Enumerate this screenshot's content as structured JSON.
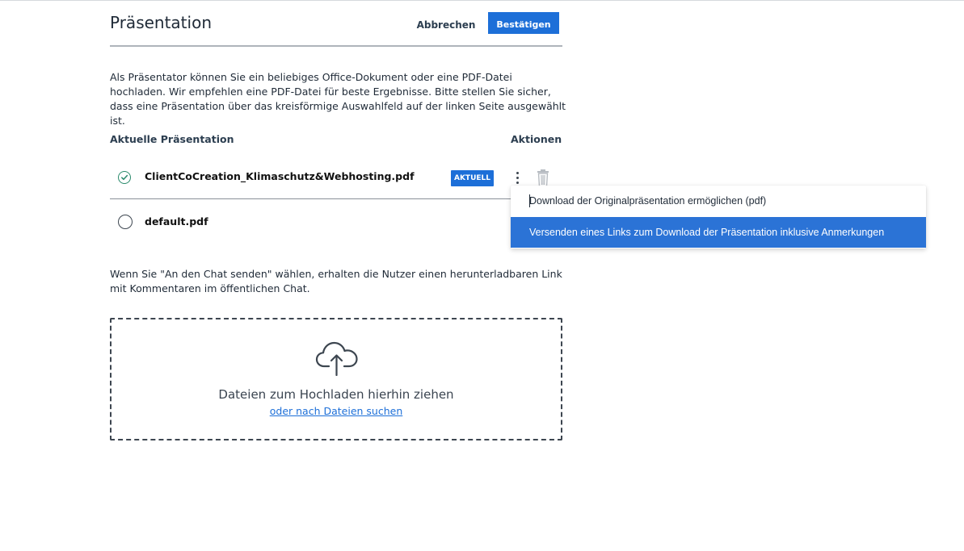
{
  "header": {
    "title": "Präsentation",
    "cancel_label": "Abbrechen",
    "confirm_label": "Bestätigen"
  },
  "intro": {
    "text": "Als Präsentator können Sie ein beliebiges Office-Dokument oder eine PDF-Datei hochladen. Wir empfehlen eine PDF-Datei für beste Ergebnisse. Bitte stellen Sie sicher, dass eine Präsentation über das kreisförmige Auswahlfeld auf der linken Seite ausgewählt ist."
  },
  "table": {
    "col_current": "Aktuelle Präsentation",
    "col_actions": "Aktionen",
    "rows": [
      {
        "name": "ClientCoCreation_Klimaschutz&Webhosting.pdf",
        "badge": "AKTUELL",
        "selected": true
      },
      {
        "name": "default.pdf",
        "selected": false
      }
    ]
  },
  "menu": {
    "items": [
      {
        "label": "Download der Originalpräsentation ermöglichen (pdf)"
      },
      {
        "label": "Versenden eines Links zum Download der Präsentation inklusive Anmerkungen"
      }
    ]
  },
  "note": {
    "text": "Wenn Sie \"An den Chat senden\" wählen, erhalten die Nutzer einen herunterladbaren Link mit Kommentaren im öffentlichen Chat."
  },
  "dropzone": {
    "main": "Dateien zum Hochladen hierhin ziehen",
    "link": "oder nach Dateien suchen"
  },
  "colors": {
    "primary": "#1d6fd8",
    "selected_check": "#2a8a6b",
    "menu_highlight": "#2b73d6"
  },
  "icons": [
    "check-circle-icon",
    "kebab-menu-icon",
    "trash-icon",
    "upload-cloud-icon"
  ]
}
